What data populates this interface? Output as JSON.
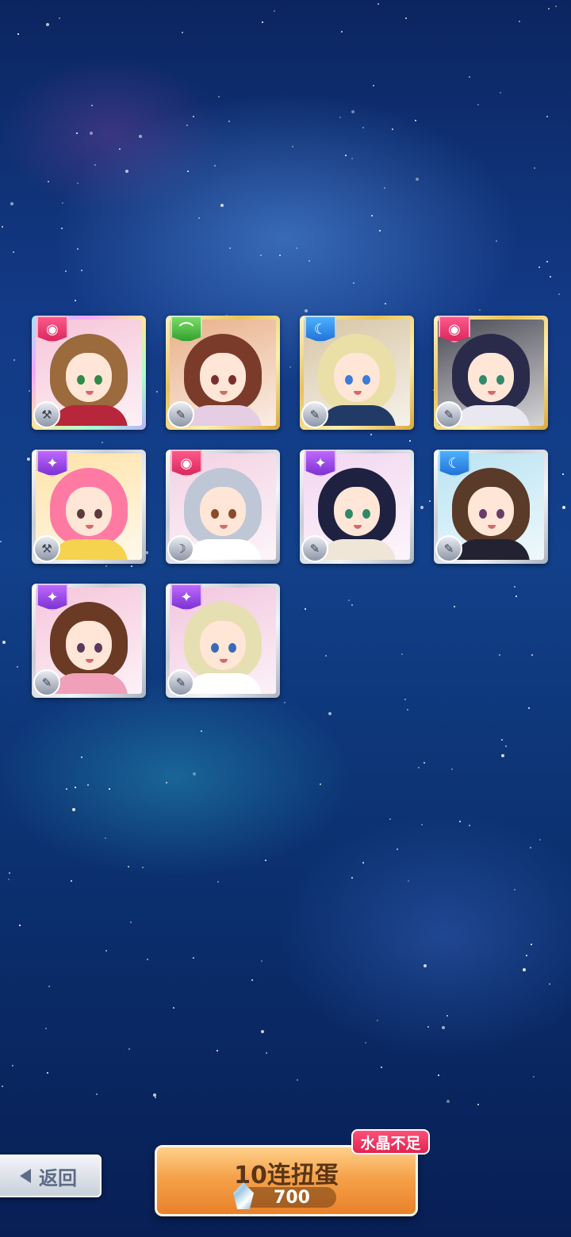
{
  "back_button": {
    "label": "返回",
    "icon": "triangle-left-icon"
  },
  "gacha_button": {
    "title": "10连扭蛋",
    "cost": "700",
    "currency_icon": "crystal-icon"
  },
  "warning_badge": {
    "label": "水晶不足"
  },
  "cards": [
    {
      "attribute": "cute",
      "frame": "rainbow",
      "skill_icon": "hammer-icon",
      "hair": "#9b6a3d",
      "bg": "#f6c5d8",
      "eye": "#2f8a4c",
      "outfit": "#b7263a"
    },
    {
      "attribute": "leaf",
      "frame": "gold",
      "skill_icon": "feather-icon",
      "hair": "#7b3b2a",
      "bg": "#e9b18a",
      "eye": "#7a2d2d",
      "outfit": "#e5cde4"
    },
    {
      "attribute": "cool",
      "frame": "gold",
      "skill_icon": "feather-icon",
      "hair": "#e9dfa7",
      "bg": "#d7c6a6",
      "eye": "#3c7bd6",
      "outfit": "#213b66"
    },
    {
      "attribute": "cute",
      "frame": "gold",
      "skill_icon": "feather-icon",
      "hair": "#2a2a4a",
      "bg": "#4b4b55",
      "eye": "#2e8a6a",
      "outfit": "#e9e7f0"
    },
    {
      "attribute": "purple",
      "frame": "silver",
      "skill_icon": "hammer-icon",
      "hair": "#ff7aa3",
      "bg": "#ffe3a8",
      "eye": "#5b3b3b",
      "outfit": "#f5d34f"
    },
    {
      "attribute": "cute",
      "frame": "silver",
      "skill_icon": "crescent-icon",
      "hair": "#bfc6d6",
      "bg": "#f3d2e3",
      "eye": "#8a4a2a",
      "outfit": "#ffffff"
    },
    {
      "attribute": "purple",
      "frame": "silver",
      "skill_icon": "feather-icon",
      "hair": "#1f2140",
      "bg": "#f2d6f0",
      "eye": "#2a8a6a",
      "outfit": "#efe6d8"
    },
    {
      "attribute": "cool",
      "frame": "silver",
      "skill_icon": "feather-icon",
      "hair": "#5a3a28",
      "bg": "#b9e3f2",
      "eye": "#6a3a6a",
      "outfit": "#222233"
    },
    {
      "attribute": "purple",
      "frame": "silver",
      "skill_icon": "feather-icon",
      "hair": "#6a3a24",
      "bg": "#f6c6db",
      "eye": "#5a3a5a",
      "outfit": "#f0a0b8"
    },
    {
      "attribute": "purple",
      "frame": "silver",
      "skill_icon": "feather-icon",
      "hair": "#e6dfb2",
      "bg": "#f2c6de",
      "eye": "#3a6ab6",
      "outfit": "#ffffff"
    }
  ]
}
